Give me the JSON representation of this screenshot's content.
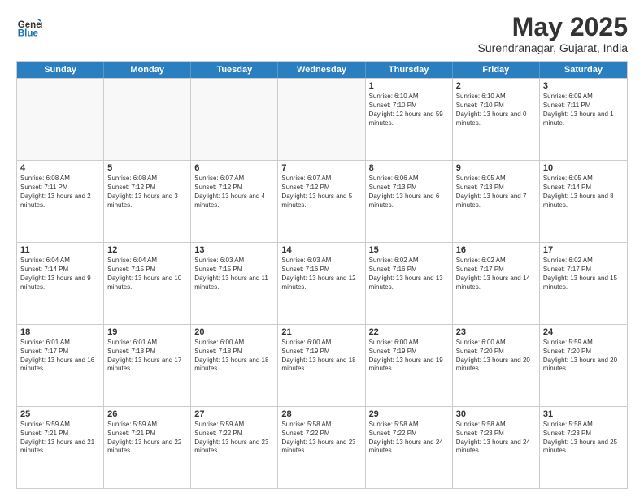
{
  "header": {
    "logo": {
      "general": "General",
      "blue": "Blue"
    },
    "title": "May 2025",
    "subtitle": "Surendranagar, Gujarat, India"
  },
  "days_of_week": [
    "Sunday",
    "Monday",
    "Tuesday",
    "Wednesday",
    "Thursday",
    "Friday",
    "Saturday"
  ],
  "weeks": [
    [
      {
        "day": "",
        "info": ""
      },
      {
        "day": "",
        "info": ""
      },
      {
        "day": "",
        "info": ""
      },
      {
        "day": "",
        "info": ""
      },
      {
        "day": "1",
        "sunrise": "Sunrise: 6:10 AM",
        "sunset": "Sunset: 7:10 PM",
        "daylight": "Daylight: 12 hours and 59 minutes."
      },
      {
        "day": "2",
        "sunrise": "Sunrise: 6:10 AM",
        "sunset": "Sunset: 7:10 PM",
        "daylight": "Daylight: 13 hours and 0 minutes."
      },
      {
        "day": "3",
        "sunrise": "Sunrise: 6:09 AM",
        "sunset": "Sunset: 7:11 PM",
        "daylight": "Daylight: 13 hours and 1 minute."
      }
    ],
    [
      {
        "day": "4",
        "sunrise": "Sunrise: 6:08 AM",
        "sunset": "Sunset: 7:11 PM",
        "daylight": "Daylight: 13 hours and 2 minutes."
      },
      {
        "day": "5",
        "sunrise": "Sunrise: 6:08 AM",
        "sunset": "Sunset: 7:12 PM",
        "daylight": "Daylight: 13 hours and 3 minutes."
      },
      {
        "day": "6",
        "sunrise": "Sunrise: 6:07 AM",
        "sunset": "Sunset: 7:12 PM",
        "daylight": "Daylight: 13 hours and 4 minutes."
      },
      {
        "day": "7",
        "sunrise": "Sunrise: 6:07 AM",
        "sunset": "Sunset: 7:12 PM",
        "daylight": "Daylight: 13 hours and 5 minutes."
      },
      {
        "day": "8",
        "sunrise": "Sunrise: 6:06 AM",
        "sunset": "Sunset: 7:13 PM",
        "daylight": "Daylight: 13 hours and 6 minutes."
      },
      {
        "day": "9",
        "sunrise": "Sunrise: 6:05 AM",
        "sunset": "Sunset: 7:13 PM",
        "daylight": "Daylight: 13 hours and 7 minutes."
      },
      {
        "day": "10",
        "sunrise": "Sunrise: 6:05 AM",
        "sunset": "Sunset: 7:14 PM",
        "daylight": "Daylight: 13 hours and 8 minutes."
      }
    ],
    [
      {
        "day": "11",
        "sunrise": "Sunrise: 6:04 AM",
        "sunset": "Sunset: 7:14 PM",
        "daylight": "Daylight: 13 hours and 9 minutes."
      },
      {
        "day": "12",
        "sunrise": "Sunrise: 6:04 AM",
        "sunset": "Sunset: 7:15 PM",
        "daylight": "Daylight: 13 hours and 10 minutes."
      },
      {
        "day": "13",
        "sunrise": "Sunrise: 6:03 AM",
        "sunset": "Sunset: 7:15 PM",
        "daylight": "Daylight: 13 hours and 11 minutes."
      },
      {
        "day": "14",
        "sunrise": "Sunrise: 6:03 AM",
        "sunset": "Sunset: 7:16 PM",
        "daylight": "Daylight: 13 hours and 12 minutes."
      },
      {
        "day": "15",
        "sunrise": "Sunrise: 6:02 AM",
        "sunset": "Sunset: 7:16 PM",
        "daylight": "Daylight: 13 hours and 13 minutes."
      },
      {
        "day": "16",
        "sunrise": "Sunrise: 6:02 AM",
        "sunset": "Sunset: 7:17 PM",
        "daylight": "Daylight: 13 hours and 14 minutes."
      },
      {
        "day": "17",
        "sunrise": "Sunrise: 6:02 AM",
        "sunset": "Sunset: 7:17 PM",
        "daylight": "Daylight: 13 hours and 15 minutes."
      }
    ],
    [
      {
        "day": "18",
        "sunrise": "Sunrise: 6:01 AM",
        "sunset": "Sunset: 7:17 PM",
        "daylight": "Daylight: 13 hours and 16 minutes."
      },
      {
        "day": "19",
        "sunrise": "Sunrise: 6:01 AM",
        "sunset": "Sunset: 7:18 PM",
        "daylight": "Daylight: 13 hours and 17 minutes."
      },
      {
        "day": "20",
        "sunrise": "Sunrise: 6:00 AM",
        "sunset": "Sunset: 7:18 PM",
        "daylight": "Daylight: 13 hours and 18 minutes."
      },
      {
        "day": "21",
        "sunrise": "Sunrise: 6:00 AM",
        "sunset": "Sunset: 7:19 PM",
        "daylight": "Daylight: 13 hours and 18 minutes."
      },
      {
        "day": "22",
        "sunrise": "Sunrise: 6:00 AM",
        "sunset": "Sunset: 7:19 PM",
        "daylight": "Daylight: 13 hours and 19 minutes."
      },
      {
        "day": "23",
        "sunrise": "Sunrise: 6:00 AM",
        "sunset": "Sunset: 7:20 PM",
        "daylight": "Daylight: 13 hours and 20 minutes."
      },
      {
        "day": "24",
        "sunrise": "Sunrise: 5:59 AM",
        "sunset": "Sunset: 7:20 PM",
        "daylight": "Daylight: 13 hours and 20 minutes."
      }
    ],
    [
      {
        "day": "25",
        "sunrise": "Sunrise: 5:59 AM",
        "sunset": "Sunset: 7:21 PM",
        "daylight": "Daylight: 13 hours and 21 minutes."
      },
      {
        "day": "26",
        "sunrise": "Sunrise: 5:59 AM",
        "sunset": "Sunset: 7:21 PM",
        "daylight": "Daylight: 13 hours and 22 minutes."
      },
      {
        "day": "27",
        "sunrise": "Sunrise: 5:59 AM",
        "sunset": "Sunset: 7:22 PM",
        "daylight": "Daylight: 13 hours and 23 minutes."
      },
      {
        "day": "28",
        "sunrise": "Sunrise: 5:58 AM",
        "sunset": "Sunset: 7:22 PM",
        "daylight": "Daylight: 13 hours and 23 minutes."
      },
      {
        "day": "29",
        "sunrise": "Sunrise: 5:58 AM",
        "sunset": "Sunset: 7:22 PM",
        "daylight": "Daylight: 13 hours and 24 minutes."
      },
      {
        "day": "30",
        "sunrise": "Sunrise: 5:58 AM",
        "sunset": "Sunset: 7:23 PM",
        "daylight": "Daylight: 13 hours and 24 minutes."
      },
      {
        "day": "31",
        "sunrise": "Sunrise: 5:58 AM",
        "sunset": "Sunset: 7:23 PM",
        "daylight": "Daylight: 13 hours and 25 minutes."
      }
    ]
  ]
}
